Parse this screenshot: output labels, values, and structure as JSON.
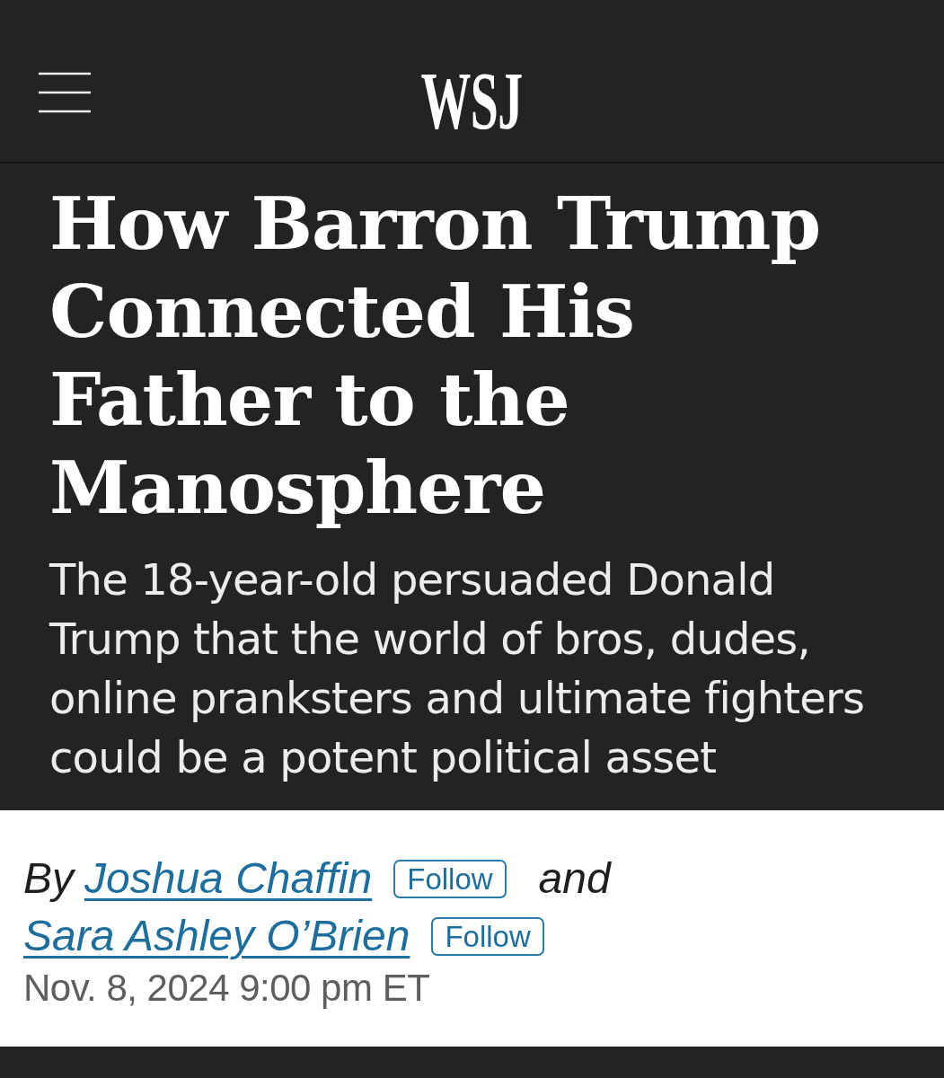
{
  "header": {
    "logo": "WSJ"
  },
  "headline": "How Barron Trump Connected His Father to the Manosphere",
  "dek": "The 18-year-old persuaded Donald Trump that the world of bros, dudes, online pranksters and ultimate fighters could be a potent political asset",
  "byline": {
    "prefix": "By",
    "conjunction": "and",
    "authors": [
      {
        "name": "Joshua Chaffin",
        "follow": "Follow"
      },
      {
        "name": "Sara Ashley O’Brien",
        "follow": "Follow"
      }
    ]
  },
  "timestamp": "Nov. 8, 2024 9:00 pm ET"
}
